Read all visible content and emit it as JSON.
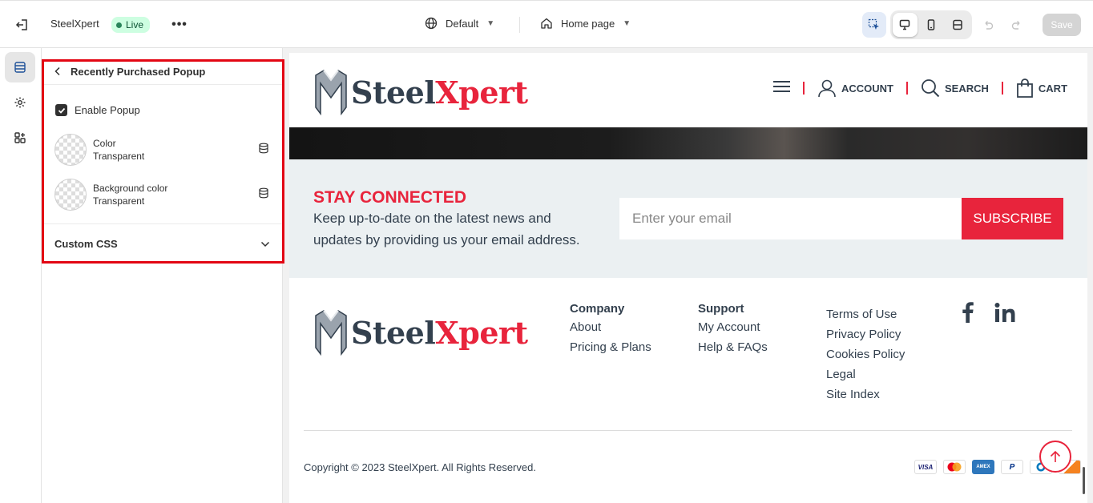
{
  "topbar": {
    "store_name": "SteelXpert",
    "live_badge": "Live",
    "theme_selector": "Default",
    "page_selector": "Home page",
    "save_label": "Save"
  },
  "panel": {
    "title": "Recently Purchased Popup",
    "enable_popup_label": "Enable Popup",
    "enable_popup_checked": true,
    "colors": [
      {
        "name": "Color",
        "value": "Transparent"
      },
      {
        "name": "Background color",
        "value": "Transparent"
      }
    ],
    "custom_css_label": "Custom CSS"
  },
  "site": {
    "logo_part1": "Steel",
    "logo_part2": "Xpert",
    "nav": {
      "account": "ACCOUNT",
      "search": "SEARCH",
      "cart": "CART"
    },
    "newsletter": {
      "title": "STAY CONNECTED",
      "text": "Keep up-to-date on the latest news and updates by providing us your email address.",
      "email_placeholder": "Enter your email",
      "subscribe_label": "SUBSCRIBE"
    },
    "footer": {
      "company": {
        "heading": "Company",
        "links": [
          "About",
          "Pricing & Plans"
        ]
      },
      "support": {
        "heading": "Support",
        "links": [
          "My Account",
          "Help & FAQs"
        ]
      },
      "legal_links": [
        "Terms of Use",
        "Privacy Policy",
        "Cookies Policy",
        "Legal",
        "Site Index"
      ],
      "copyright": "Copyright © 2023 SteelXpert. All Rights Reserved.",
      "payment_icons": [
        "visa-icon",
        "mastercard-icon",
        "amex-icon",
        "paypal-icon",
        "diners-icon",
        "discover-icon"
      ]
    }
  },
  "colors": {
    "brand_red": "#e8243c",
    "brand_dark": "#33404e",
    "live_bg": "#cdfee1",
    "highlight_red": "#e30613"
  }
}
